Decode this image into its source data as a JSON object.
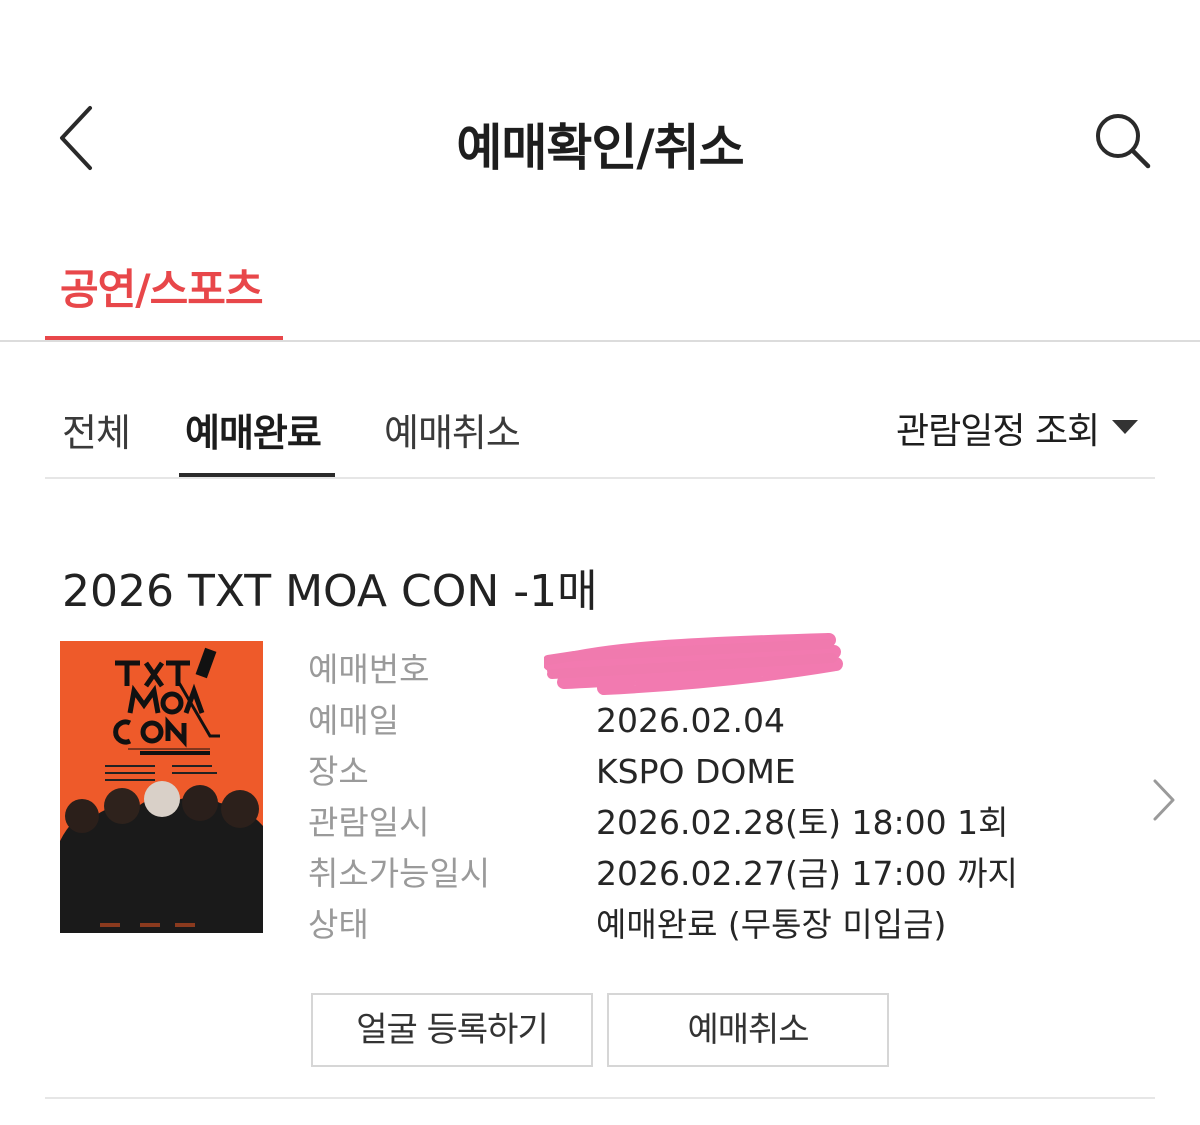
{
  "header": {
    "title": "예매확인/취소",
    "back_icon": "chevron-left-icon",
    "search_icon": "search-icon"
  },
  "main_tab": {
    "label": "공연/스포츠",
    "accent_color": "#e8474a"
  },
  "filter_tabs": {
    "items": [
      {
        "label": "전체",
        "active": false
      },
      {
        "label": "예매완료",
        "active": true
      },
      {
        "label": "예매취소",
        "active": false
      }
    ],
    "date_filter_label": "관람일정 조회"
  },
  "booking": {
    "title": "2026 TXT MOA CON -1매",
    "poster": {
      "logo_text": "TXT MOA CON",
      "subtitle": "2026 TXT MOA CON",
      "background_color": "#ee5a2a"
    },
    "labels": {
      "booking_number": "예매번호",
      "booking_date": "예매일",
      "venue": "장소",
      "show_datetime": "관람일시",
      "cancel_deadline": "취소가능일시",
      "status": "상태"
    },
    "values": {
      "booking_number": "",
      "booking_date": "2026.02.04",
      "venue": "KSPO DOME",
      "show_datetime": "2026.02.28(토) 18:00 1회",
      "cancel_deadline": "2026.02.27(금) 17:00 까지",
      "status": "예매완료 (무통장 미입금)"
    },
    "buttons": {
      "face_register": "얼굴 등록하기",
      "cancel": "예매취소"
    }
  }
}
